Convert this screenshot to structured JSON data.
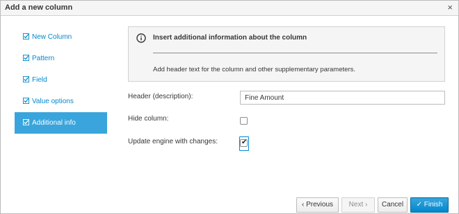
{
  "dialog": {
    "title": "Add a new column",
    "close_icon": "close-icon",
    "close_glyph": "×"
  },
  "sidebar": {
    "items": [
      {
        "label": "New Column",
        "icon": "check-square-icon",
        "active": false
      },
      {
        "label": "Pattern",
        "icon": "check-square-icon",
        "active": false
      },
      {
        "label": "Field",
        "icon": "check-square-icon",
        "active": false
      },
      {
        "label": "Value options",
        "icon": "check-square-icon",
        "active": false
      },
      {
        "label": "Additional info",
        "icon": "check-square-icon",
        "active": true
      }
    ]
  },
  "info": {
    "icon": "info-icon",
    "title": "Insert additional information about the column",
    "text": "Add header text for the column and other supplementary parameters."
  },
  "form": {
    "header_label": "Header (description):",
    "header_value": "Fine Amount",
    "hide_label": "Hide column:",
    "hide_checked": false,
    "update_label": "Update engine with changes:",
    "update_checked": true
  },
  "footer": {
    "previous_label": "‹ Previous",
    "next_label": "Next ›",
    "cancel_label": "Cancel",
    "finish_label": "✓ Finish"
  },
  "colors": {
    "accent": "#0088ce",
    "active_bg": "#39a5dc",
    "header_bg": "#f5f5f5"
  }
}
